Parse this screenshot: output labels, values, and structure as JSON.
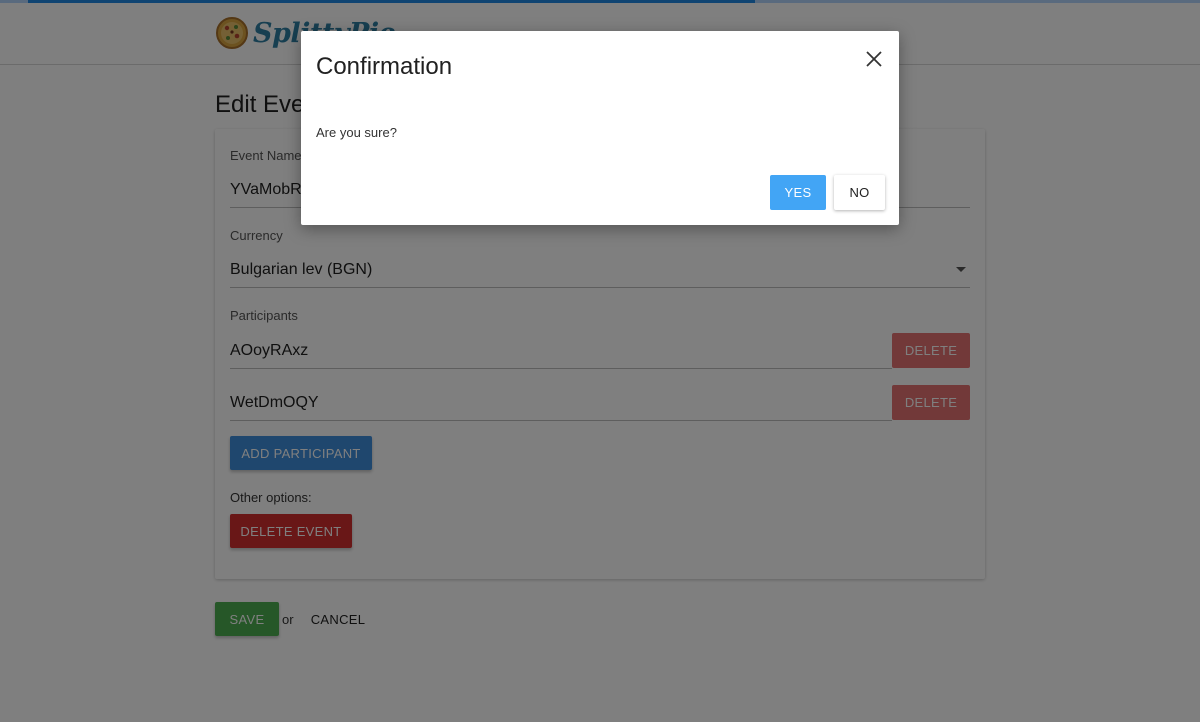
{
  "header": {
    "logo_text": "SplittyPie",
    "progress_percent": 62
  },
  "page": {
    "title": "Edit Event"
  },
  "form": {
    "event_name_label": "Event Name",
    "event_name_value": "YVaMobRcEvent",
    "currency_label": "Currency",
    "currency_value": "Bulgarian lev (BGN)",
    "participants_label": "Participants",
    "participants": [
      {
        "name": "AOoyRAxz",
        "delete_label": "DELETE"
      },
      {
        "name": "WetDmOQY",
        "delete_label": "DELETE"
      }
    ],
    "add_participant_label": "ADD PARTICIPANT",
    "other_options_label": "Other options:",
    "delete_event_label": "DELETE EVENT"
  },
  "footer": {
    "save_label": "SAVE",
    "or_text": "or",
    "cancel_label": "CANCEL"
  },
  "modal": {
    "title": "Confirmation",
    "body": "Are you sure?",
    "yes_label": "YES",
    "no_label": "NO",
    "close_icon": "close-icon"
  },
  "colors": {
    "primary": "#3f8fdc",
    "danger": "#d32f2f",
    "danger_light": "#e57373",
    "success": "#4caf50",
    "modal_yes": "#42a5f5"
  }
}
